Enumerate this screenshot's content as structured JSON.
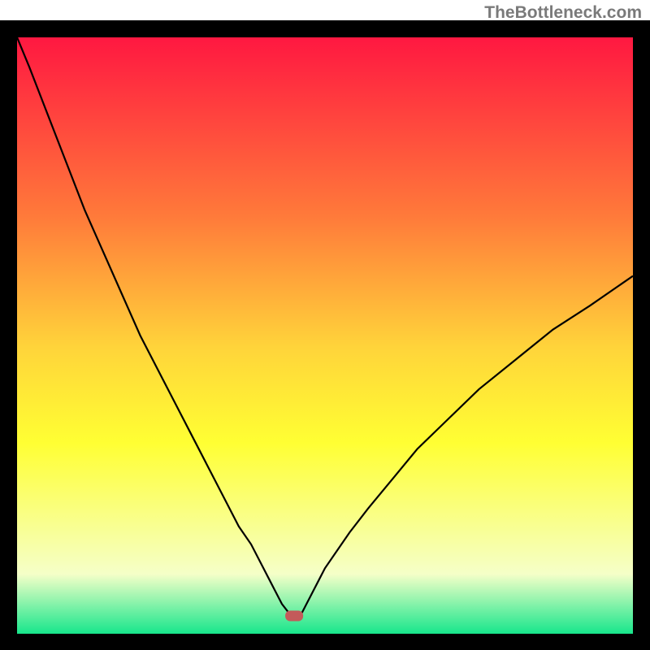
{
  "watermark": "TheBottleneck.com",
  "chart_data": {
    "type": "line",
    "title": "",
    "xlabel": "",
    "ylabel": "",
    "xlim": [
      0,
      100
    ],
    "ylim": [
      0,
      100
    ],
    "x": [
      0,
      2,
      5,
      8,
      11,
      14,
      17,
      20,
      24,
      28,
      31,
      34,
      36,
      38,
      40,
      41,
      42,
      43,
      44.5,
      46,
      47,
      48,
      49,
      50,
      52,
      54,
      57,
      61,
      65,
      70,
      75,
      81,
      87,
      93,
      100
    ],
    "values": [
      100,
      95,
      87,
      79,
      71,
      64,
      57,
      50,
      42,
      34,
      28,
      22,
      18,
      15,
      11,
      9,
      7,
      5,
      3,
      3,
      5,
      7,
      9,
      11,
      14,
      17,
      21,
      26,
      31,
      36,
      41,
      46,
      51,
      55,
      60
    ],
    "marker_point": {
      "x": 45,
      "y": 3
    }
  },
  "colors": {
    "top": "#ff1841",
    "mid1": "#ff7a3a",
    "mid2": "#ffd43a",
    "mid3": "#ffff33",
    "mid4": "#f5ffc8",
    "bottom": "#17e68c",
    "marker": "#c35a5a",
    "line": "#000000"
  }
}
